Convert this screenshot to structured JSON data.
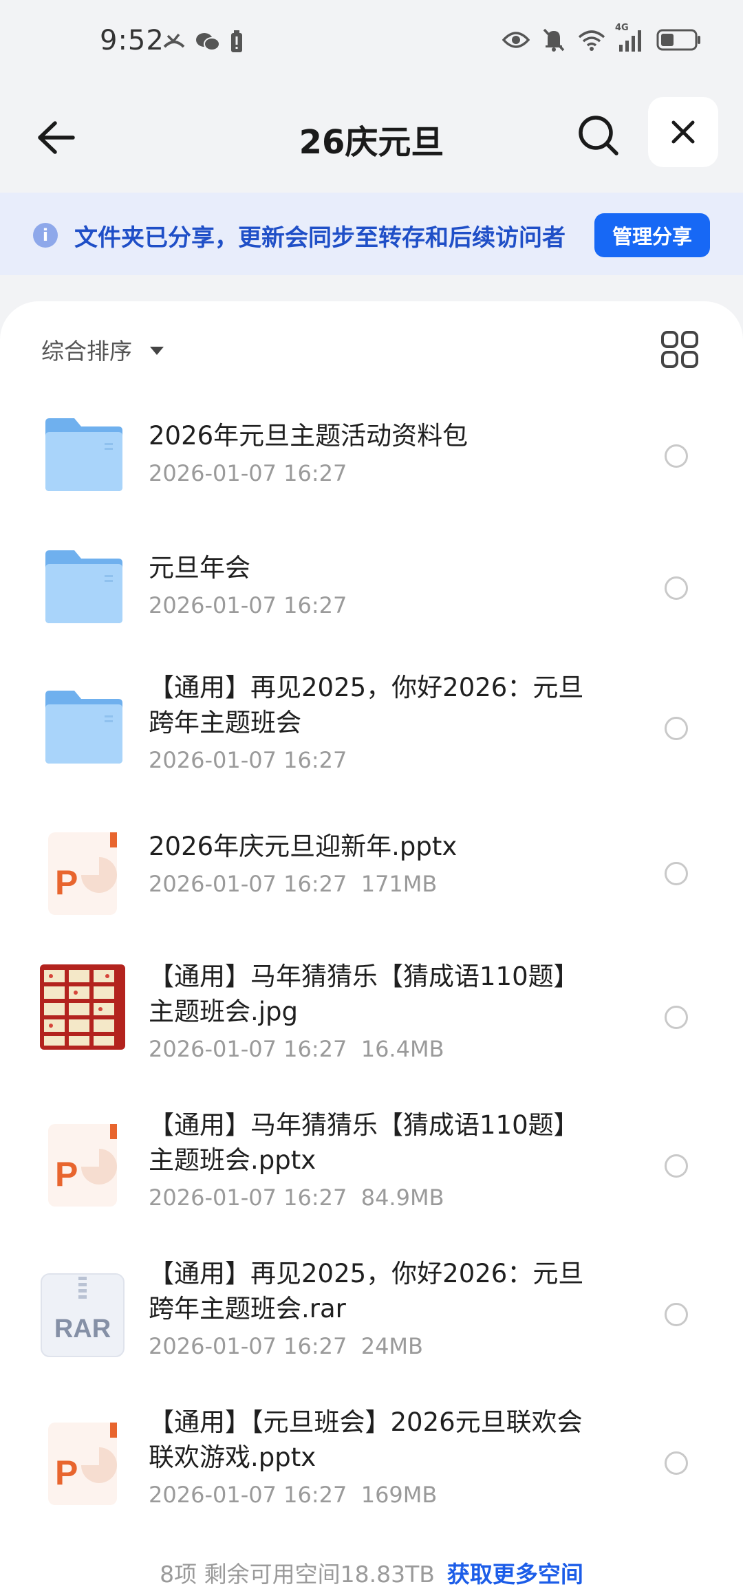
{
  "status_bar": {
    "time": "9:52",
    "network": "4G"
  },
  "header": {
    "title": "26庆元旦"
  },
  "banner": {
    "text": "文件夹已分享，更新会同步至转存和后续访问者",
    "button_label": "管理分享"
  },
  "toolbar": {
    "sort_label": "综合排序"
  },
  "files": [
    {
      "name": "2026年元旦主题活动资料包",
      "meta": "2026-01-07 16:27",
      "type": "folder"
    },
    {
      "name": "元旦年会",
      "meta": "2026-01-07 16:27",
      "type": "folder"
    },
    {
      "name": "【通用】再见2025，你好2026：元旦跨年主题班会",
      "meta": "2026-01-07 16:27",
      "type": "folder"
    },
    {
      "name": "2026年庆元旦迎新年.pptx",
      "meta": "2026-01-07 16:27  171MB",
      "type": "pptx"
    },
    {
      "name": "【通用】马年猜猜乐【猜成语110题】主题班会.jpg",
      "meta": "2026-01-07 16:27  16.4MB",
      "type": "jpg"
    },
    {
      "name": "【通用】马年猜猜乐【猜成语110题】主题班会.pptx",
      "meta": "2026-01-07 16:27  84.9MB",
      "type": "pptx"
    },
    {
      "name": "【通用】再见2025，你好2026：元旦跨年主题班会.rar",
      "meta": "2026-01-07 16:27  24MB",
      "type": "rar"
    },
    {
      "name": "【通用】【元旦班会】2026元旦联欢会联欢游戏.pptx",
      "meta": "2026-01-07 16:27  169MB",
      "type": "pptx"
    }
  ],
  "icons": {
    "ppt_letter": "P",
    "rar_label": "RAR"
  },
  "footer": {
    "summary": "8项 剩余可用空间18.83TB",
    "link": "获取更多空间"
  },
  "colors": {
    "accent": "#1768f5",
    "banner_bg": "#e8edfb",
    "folder": "#7fbcf2",
    "ppt": "#e8652e"
  }
}
